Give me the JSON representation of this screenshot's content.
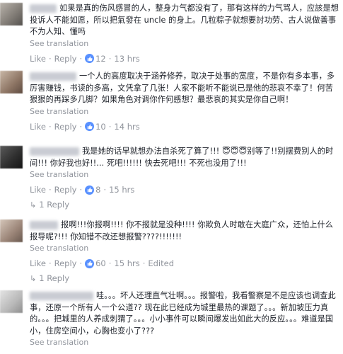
{
  "comments": [
    {
      "text": "如果是真的伤风感冒的人，整身力气都没有了，那有这样的力气骂人，应該是想投诉人不能如愿，所以把氣發在 uncle 的身上。几粒粽子就想要討功劳、古人说做善事不为人知、懂吗",
      "see_translation": "See translation",
      "like": "Like",
      "reply": "Reply",
      "likes": "12",
      "time": "13 hrs",
      "edited": ""
    },
    {
      "text": "一个人的高度取决于涵养修养，取决于处事的宽度，不是你有多本事，多厉害赚钱，书读的多高，文凭拿了几张！人家不能听不能说已是他的悲哀不幸了！何苦狠狠的再踩多几脚？如果角色对调你作何感想？最悲哀的其实是你自己啊！",
      "see_translation": "See translation",
      "like": "Like",
      "reply": "Reply",
      "likes": "10",
      "time": "14 hrs",
      "edited": ""
    },
    {
      "text": "我是她的话早就想办法自杀死了算了!!! 😇😇😇别等了!!别摆费别人的时间!!! 你好我也好!!... 死吧!!!!!! 快去死吧!!! 不死也没用了!!!",
      "see_translation": "See translation",
      "like": "Like",
      "reply": "Reply",
      "likes": "8",
      "time": "15 hrs",
      "edited": "",
      "reply_count_label": "1 Reply"
    },
    {
      "text": "报啊!!!你报啊!!!! 你不报就是没种!!!! 你欺负人时敢在大庭广众，还怕上什么报导呢?!!! 你知错不改还想报警????!!!!!!!",
      "see_translation": "See translation",
      "like": "Like",
      "reply": "Reply",
      "likes": "60",
      "time": "15 hrs",
      "edited": "Edited",
      "reply_count_label": "1 Reply"
    },
    {
      "text": "哇。。。坏人还理直气壮啊。。。报警啦，我看警察是不是应该也调查此事，还原一个所有人一个公道?? 现在此已经成为城里最热的课题了。。。新加坡压力真的。。。把城里的人养成刺猬了。。。小小事件可以瞬间爆发出如此大的反应。。。难道是国小，住房空间小，心胸也变小了???",
      "see_translation": "See translation",
      "like": "",
      "reply": "",
      "likes": "",
      "time": "",
      "edited": ""
    }
  ],
  "icons": {
    "like_badge": "thumbs-up-icon",
    "reply_arrow": "reply-arrow-icon"
  },
  "colors": {
    "link": "#90949c",
    "like_badge": "#5890ff",
    "text": "#1d2129"
  }
}
